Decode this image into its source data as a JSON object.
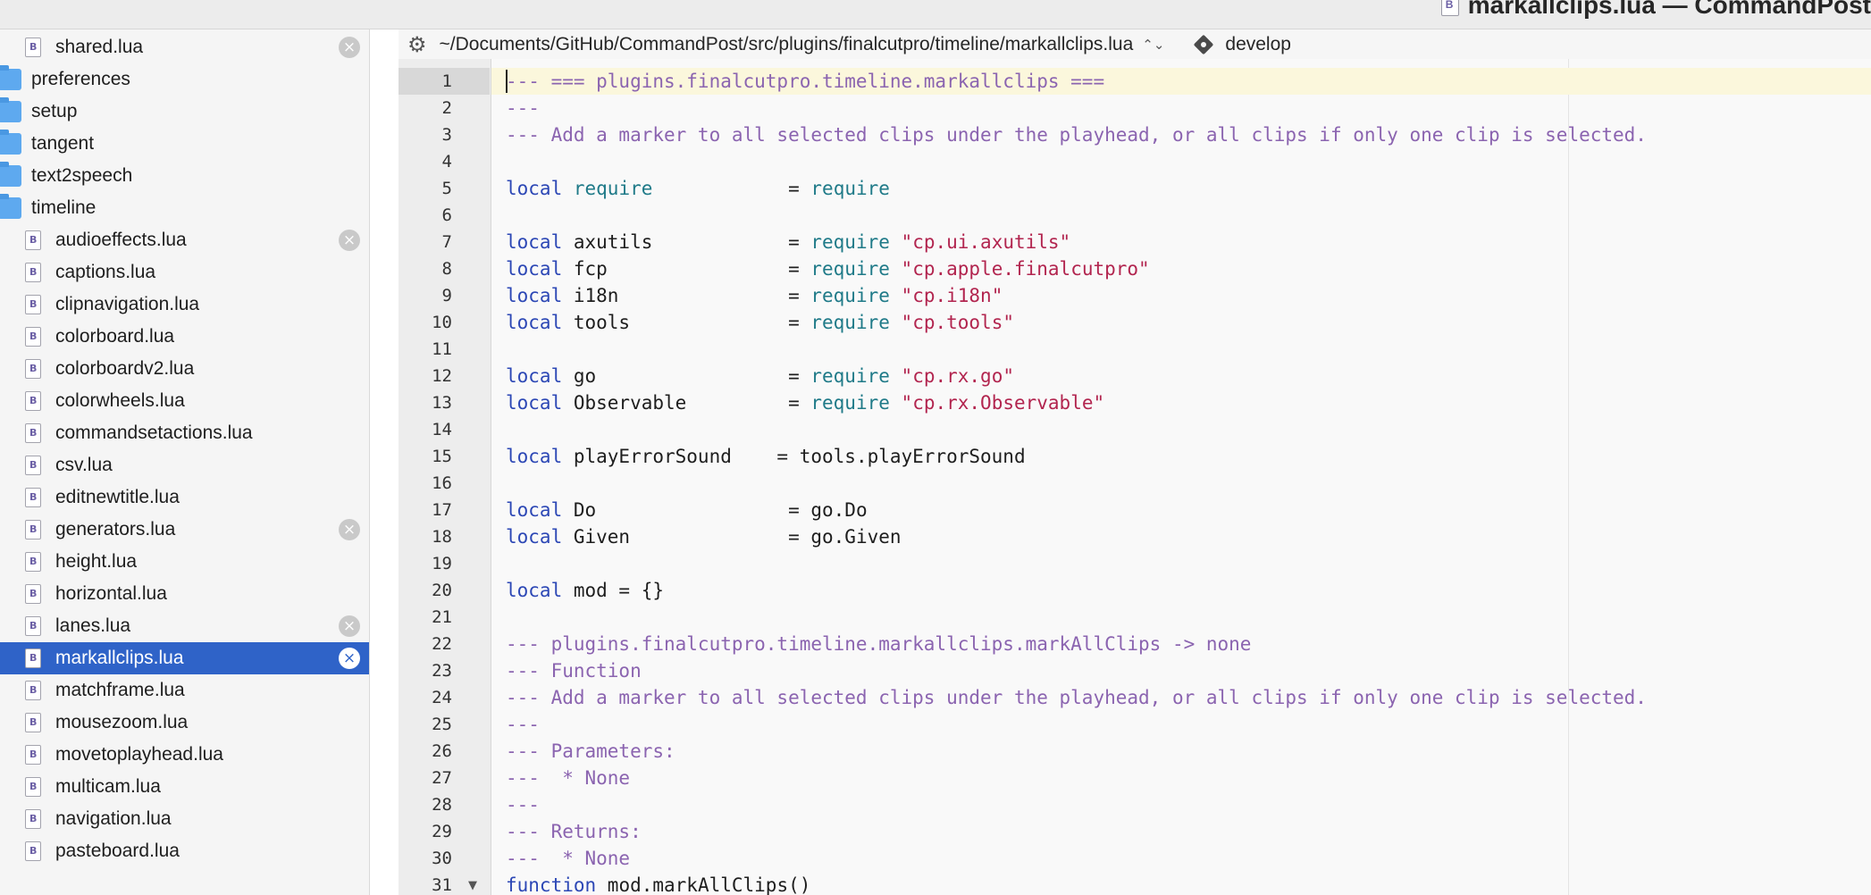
{
  "window": {
    "title": "markallclips.lua — CommandPost"
  },
  "colors": {
    "selection": "#2f63c8",
    "comment": "#8b64b0",
    "keyword": "#2c47b5",
    "builtin": "#1f7a88",
    "string": "#b2254f"
  },
  "pathbar": {
    "settings_icon": "gear-icon",
    "path": "~/Documents/GitHub/CommandPost/src/plugins/finalcutpro/timeline/markallclips.lua",
    "branch": "develop"
  },
  "sidebar": {
    "items": [
      {
        "label": "shared.lua",
        "type": "file",
        "closable": true
      },
      {
        "label": "preferences",
        "type": "folder"
      },
      {
        "label": "setup",
        "type": "folder"
      },
      {
        "label": "tangent",
        "type": "folder"
      },
      {
        "label": "text2speech",
        "type": "folder"
      },
      {
        "label": "timeline",
        "type": "folder"
      },
      {
        "label": "audioeffects.lua",
        "type": "file",
        "closable": true
      },
      {
        "label": "captions.lua",
        "type": "file"
      },
      {
        "label": "clipnavigation.lua",
        "type": "file"
      },
      {
        "label": "colorboard.lua",
        "type": "file"
      },
      {
        "label": "colorboardv2.lua",
        "type": "file"
      },
      {
        "label": "colorwheels.lua",
        "type": "file"
      },
      {
        "label": "commandsetactions.lua",
        "type": "file"
      },
      {
        "label": "csv.lua",
        "type": "file"
      },
      {
        "label": "editnewtitle.lua",
        "type": "file"
      },
      {
        "label": "generators.lua",
        "type": "file",
        "closable": true
      },
      {
        "label": "height.lua",
        "type": "file"
      },
      {
        "label": "horizontal.lua",
        "type": "file"
      },
      {
        "label": "lanes.lua",
        "type": "file",
        "closable": true
      },
      {
        "label": "markallclips.lua",
        "type": "file",
        "closable": true,
        "selected": true
      },
      {
        "label": "matchframe.lua",
        "type": "file"
      },
      {
        "label": "mousezoom.lua",
        "type": "file"
      },
      {
        "label": "movetoplayhead.lua",
        "type": "file"
      },
      {
        "label": "multicam.lua",
        "type": "file"
      },
      {
        "label": "navigation.lua",
        "type": "file"
      },
      {
        "label": "pasteboard.lua",
        "type": "file"
      }
    ]
  },
  "editor": {
    "current_line": 1,
    "folded_line": 31,
    "lines": [
      {
        "n": "1",
        "t": [
          [
            "cmt",
            "--- === plugins.finalcutpro.timeline.markallclips ==="
          ]
        ]
      },
      {
        "n": "2",
        "t": [
          [
            "cmt",
            "---"
          ]
        ]
      },
      {
        "n": "3",
        "t": [
          [
            "cmt",
            "--- Add a marker to all selected clips under the playhead, or all clips if only one clip is selected."
          ]
        ]
      },
      {
        "n": "4",
        "t": []
      },
      {
        "n": "5",
        "t": [
          [
            "kw",
            "local"
          ],
          [
            "txt",
            " "
          ],
          [
            "fn",
            "require"
          ],
          [
            "txt",
            "            = "
          ],
          [
            "fn",
            "require"
          ]
        ]
      },
      {
        "n": "6",
        "t": []
      },
      {
        "n": "7",
        "t": [
          [
            "kw",
            "local"
          ],
          [
            "txt",
            " axutils            = "
          ],
          [
            "fn",
            "require"
          ],
          [
            "txt",
            " "
          ],
          [
            "str",
            "\"cp.ui.axutils\""
          ]
        ]
      },
      {
        "n": "8",
        "t": [
          [
            "kw",
            "local"
          ],
          [
            "txt",
            " fcp                = "
          ],
          [
            "fn",
            "require"
          ],
          [
            "txt",
            " "
          ],
          [
            "str",
            "\"cp.apple.finalcutpro\""
          ]
        ]
      },
      {
        "n": "9",
        "t": [
          [
            "kw",
            "local"
          ],
          [
            "txt",
            " i18n               = "
          ],
          [
            "fn",
            "require"
          ],
          [
            "txt",
            " "
          ],
          [
            "str",
            "\"cp.i18n\""
          ]
        ]
      },
      {
        "n": "10",
        "t": [
          [
            "kw",
            "local"
          ],
          [
            "txt",
            " tools              = "
          ],
          [
            "fn",
            "require"
          ],
          [
            "txt",
            " "
          ],
          [
            "str",
            "\"cp.tools\""
          ]
        ]
      },
      {
        "n": "11",
        "t": []
      },
      {
        "n": "12",
        "t": [
          [
            "kw",
            "local"
          ],
          [
            "txt",
            " go                 = "
          ],
          [
            "fn",
            "require"
          ],
          [
            "txt",
            " "
          ],
          [
            "str",
            "\"cp.rx.go\""
          ]
        ]
      },
      {
        "n": "13",
        "t": [
          [
            "kw",
            "local"
          ],
          [
            "txt",
            " Observable         = "
          ],
          [
            "fn",
            "require"
          ],
          [
            "txt",
            " "
          ],
          [
            "str",
            "\"cp.rx.Observable\""
          ]
        ]
      },
      {
        "n": "14",
        "t": []
      },
      {
        "n": "15",
        "t": [
          [
            "kw",
            "local"
          ],
          [
            "txt",
            " playErrorSound    = tools.playErrorSound"
          ]
        ]
      },
      {
        "n": "16",
        "t": []
      },
      {
        "n": "17",
        "t": [
          [
            "kw",
            "local"
          ],
          [
            "txt",
            " Do                 = go.Do"
          ]
        ]
      },
      {
        "n": "18",
        "t": [
          [
            "kw",
            "local"
          ],
          [
            "txt",
            " Given              = go.Given"
          ]
        ]
      },
      {
        "n": "19",
        "t": []
      },
      {
        "n": "20",
        "t": [
          [
            "kw",
            "local"
          ],
          [
            "txt",
            " mod = {}"
          ]
        ]
      },
      {
        "n": "21",
        "t": []
      },
      {
        "n": "22",
        "t": [
          [
            "cmt",
            "--- plugins.finalcutpro.timeline.markallclips.markAllClips -> none"
          ]
        ]
      },
      {
        "n": "23",
        "t": [
          [
            "cmt",
            "--- Function"
          ]
        ]
      },
      {
        "n": "24",
        "t": [
          [
            "cmt",
            "--- Add a marker to all selected clips under the playhead, or all clips if only one clip is selected."
          ]
        ]
      },
      {
        "n": "25",
        "t": [
          [
            "cmt",
            "---"
          ]
        ]
      },
      {
        "n": "26",
        "t": [
          [
            "cmt",
            "--- Parameters:"
          ]
        ]
      },
      {
        "n": "27",
        "t": [
          [
            "cmt",
            "---  * None"
          ]
        ]
      },
      {
        "n": "28",
        "t": [
          [
            "cmt",
            "---"
          ]
        ]
      },
      {
        "n": "29",
        "t": [
          [
            "cmt",
            "--- Returns:"
          ]
        ]
      },
      {
        "n": "30",
        "t": [
          [
            "cmt",
            "---  * None"
          ]
        ]
      },
      {
        "n": "31",
        "t": [
          [
            "kw",
            "function"
          ],
          [
            "txt",
            " mod.markAllClips()"
          ]
        ]
      }
    ]
  }
}
